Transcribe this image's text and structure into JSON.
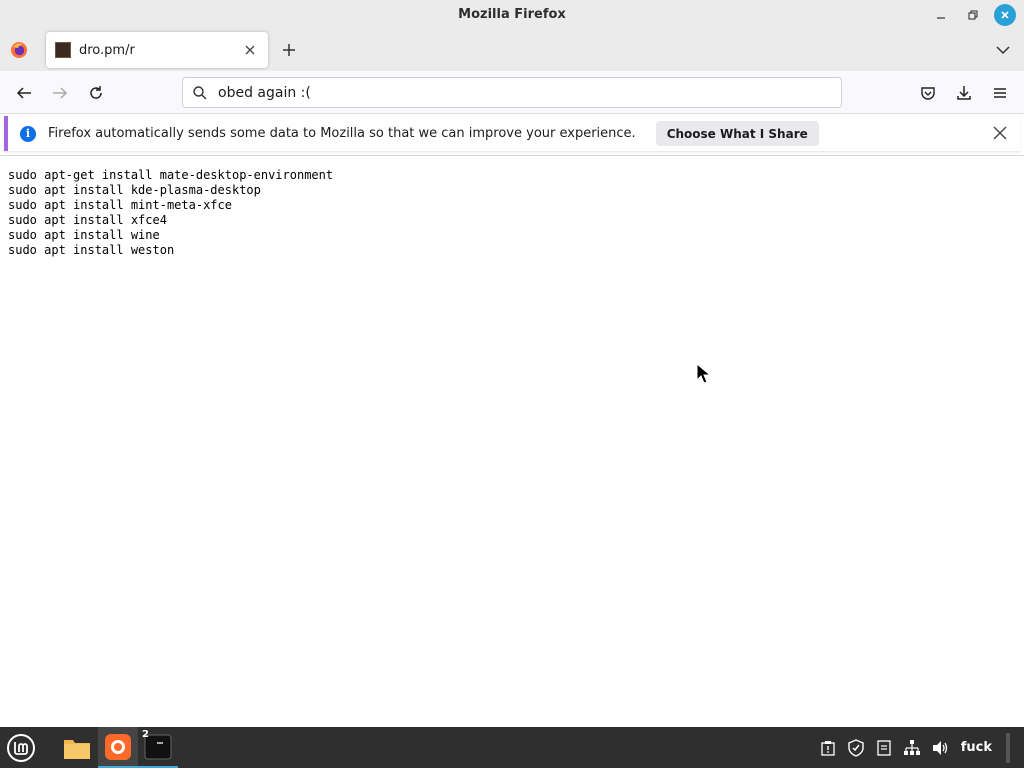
{
  "window": {
    "title": "Mozilla Firefox"
  },
  "tabs": [
    {
      "label": "dro.pm/r",
      "active": true
    }
  ],
  "navbar": {
    "url_value": "obed again :("
  },
  "notification": {
    "message": "Firefox automatically sends some data to Mozilla so that we can improve your experience.",
    "button_label": "Choose What I Share"
  },
  "content": {
    "lines": [
      "sudo apt-get install mate-desktop-environment",
      "sudo apt install kde-plasma-desktop",
      "sudo apt install mint-meta-xfce",
      "sudo apt install xfce4",
      "sudo apt install wine",
      "sudo apt install weston"
    ]
  },
  "taskbar": {
    "terminal_badge": "2",
    "tray_label": "fuck",
    "accent_color": "#3fa9d7"
  },
  "colors": {
    "notification_accent": "#a267e0",
    "info_icon": "#0e6ee8",
    "close_button": "#2aa1d6"
  },
  "icons": [
    "firefox-icon",
    "tab-favicon",
    "close-icon",
    "plus-icon",
    "chevron-down-icon",
    "back-icon",
    "forward-icon",
    "reload-icon",
    "search-icon",
    "pocket-icon",
    "download-icon",
    "menu-icon",
    "info-icon",
    "mint-menu-icon",
    "folder-icon",
    "firefox-taskbar-icon",
    "terminal-icon",
    "clipboard-icon",
    "shield-icon",
    "notes-icon",
    "network-icon",
    "volume-icon"
  ]
}
